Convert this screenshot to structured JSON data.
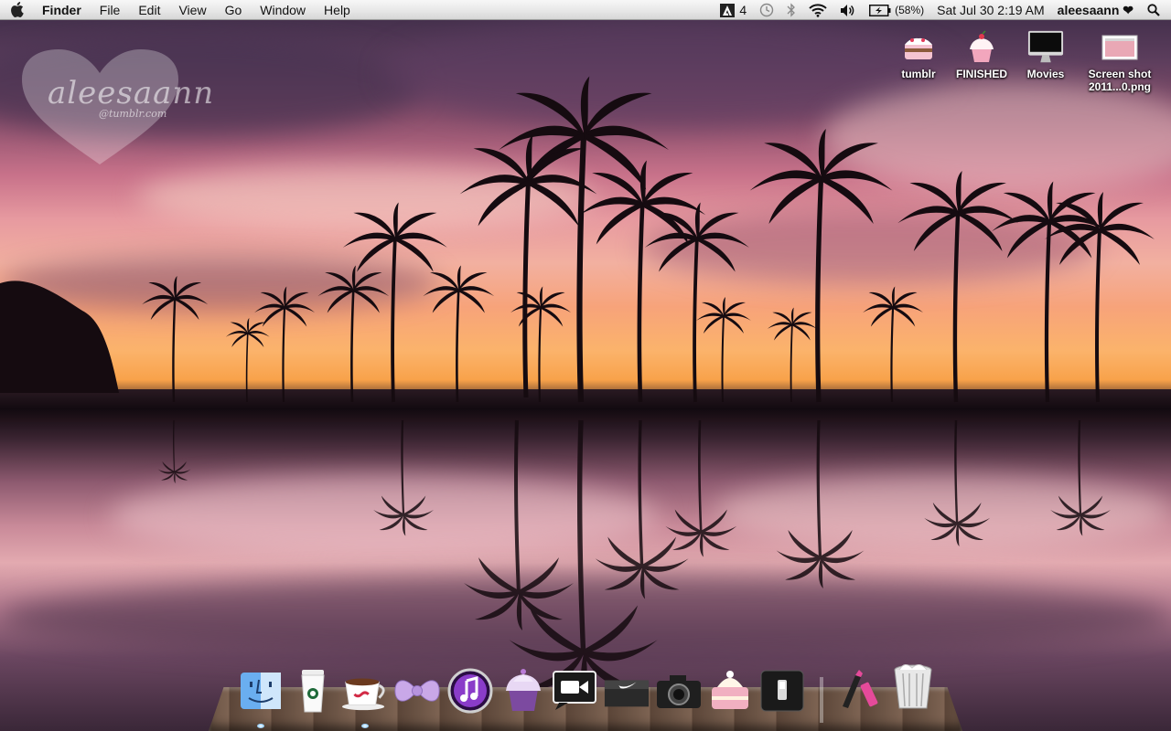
{
  "menubar": {
    "app_name": "Finder",
    "menus": [
      "File",
      "Edit",
      "View",
      "Go",
      "Window",
      "Help"
    ],
    "status": {
      "adobe_count": "4",
      "battery_percent": "(58%)",
      "datetime": "Sat Jul 30  2:19 AM",
      "user": "aleesaann ❤"
    }
  },
  "watermark": {
    "text": "aleesaann",
    "sub": "@tumblr.com"
  },
  "desktop_icons": [
    {
      "label": "tumblr",
      "icon": "cake-icon"
    },
    {
      "label": "FINISHED",
      "icon": "cupcake-icon"
    },
    {
      "label": "Movies",
      "icon": "imac-icon"
    },
    {
      "label": "Screen shot 2011...0.png",
      "icon": "screenshot-file-icon"
    }
  ],
  "dock": {
    "items": [
      {
        "name": "finder",
        "icon": "finder-icon",
        "running": true
      },
      {
        "name": "coffee-cup",
        "icon": "starbucks-cup-icon",
        "running": true
      },
      {
        "name": "coffee-mug",
        "icon": "coffee-mug-icon",
        "running": false
      },
      {
        "name": "bow",
        "icon": "bow-icon",
        "running": false
      },
      {
        "name": "itunes",
        "icon": "itunes-icon",
        "running": false
      },
      {
        "name": "cupcake",
        "icon": "cupcake-icon",
        "running": false
      },
      {
        "name": "video-chat",
        "icon": "video-camera-icon",
        "running": false
      },
      {
        "name": "nike-box",
        "icon": "nike-box-icon",
        "running": false
      },
      {
        "name": "camera",
        "icon": "camera-icon",
        "running": false
      },
      {
        "name": "cake",
        "icon": "cake-icon",
        "running": false
      },
      {
        "name": "switch",
        "icon": "switch-icon",
        "running": false
      },
      {
        "name": "makeup",
        "icon": "makeup-icon",
        "running": false
      },
      {
        "name": "trash",
        "icon": "trash-icon",
        "running": false
      }
    ]
  }
}
